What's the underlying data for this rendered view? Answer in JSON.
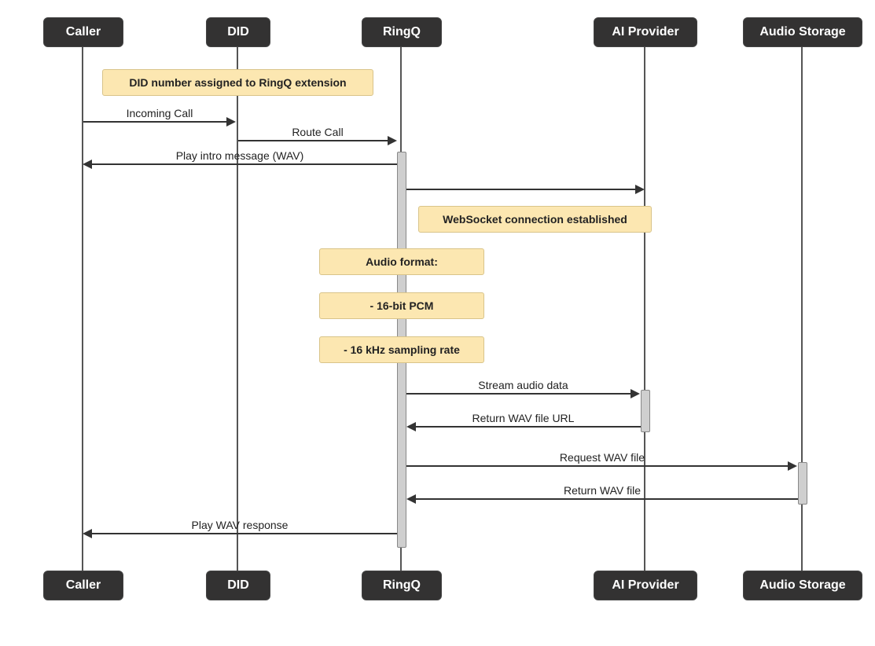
{
  "participants": {
    "caller": "Caller",
    "did": "DID",
    "ringq": "RingQ",
    "ai_provider": "AI Provider",
    "audio_storage": "Audio Storage"
  },
  "notes": {
    "did_assigned": "DID number assigned to RingQ extension",
    "ws_established": "WebSocket connection established",
    "audio_format": "Audio format:",
    "pcm": "- 16-bit PCM",
    "sampling": "- 16 kHz sampling rate"
  },
  "messages": {
    "incoming_call": "Incoming Call",
    "route_call": "Route Call",
    "play_intro": "Play intro message (WAV)",
    "stream_audio": "Stream audio data",
    "return_wav_url": "Return WAV file URL",
    "request_wav": "Request WAV file",
    "return_wav": "Return WAV file",
    "play_wav_response": "Play WAV response"
  }
}
